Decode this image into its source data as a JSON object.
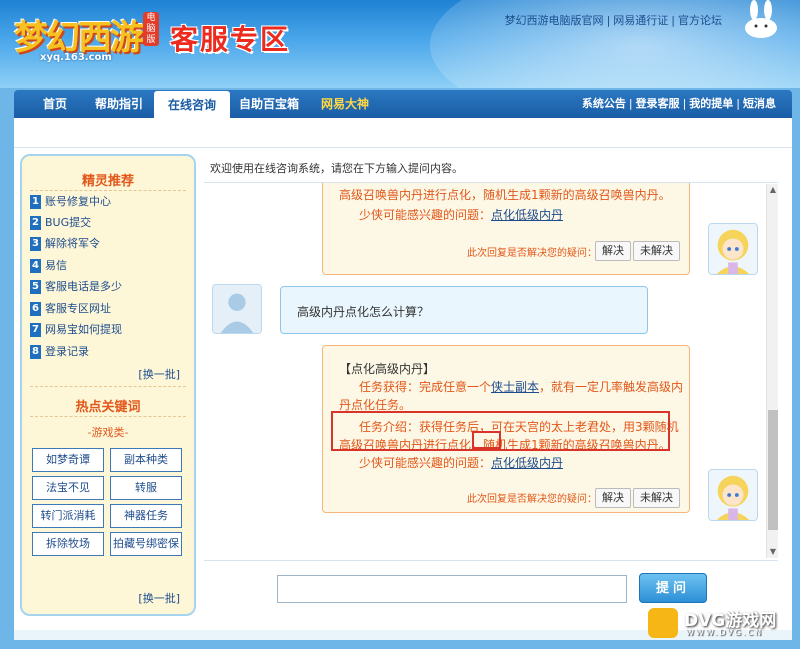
{
  "header": {
    "logo_text": "梦幻西游",
    "logo_tag": "电脑版",
    "logo_url": "xyq.163.com",
    "zone_title": "客服专区",
    "top_links": [
      "梦幻西游电脑版官网",
      "网易通行证",
      "官方论坛"
    ]
  },
  "nav": {
    "items": [
      "首页",
      "帮助指引",
      "在线咨询",
      "自助百宝箱",
      "网易大神"
    ],
    "active": "在线咨询",
    "right_links": [
      "系统公告",
      "登录客服",
      "我的提单",
      "短消息"
    ]
  },
  "left_panel": {
    "title": "精灵推荐",
    "items": [
      {
        "num": "1",
        "label": "账号修复中心"
      },
      {
        "num": "2",
        "label": "BUG提交"
      },
      {
        "num": "3",
        "label": "解除将军令"
      },
      {
        "num": "4",
        "label": "易信"
      },
      {
        "num": "5",
        "label": "客服电话是多少"
      },
      {
        "num": "6",
        "label": "客服专区网址"
      },
      {
        "num": "7",
        "label": "网易宝如何提现"
      },
      {
        "num": "8",
        "label": "登录记录"
      }
    ],
    "more_label": "[换一批]",
    "keywords_title": "热点关键词",
    "keywords_sub": "-游戏类-",
    "keywords": [
      "如梦奇谭",
      "副本种类",
      "法宝不见",
      "转服",
      "转门派消耗",
      "神器任务",
      "拆除牧场",
      "拍藏号绑密保"
    ],
    "keywords_more": "[换一批]"
  },
  "chat": {
    "welcome": "欢迎使用在线咨询系统，请您在下方输入提问内容。",
    "msg1": {
      "line1": "高级召唤兽内丹进行点化，随机生成1颗新的高级召唤兽内丹。",
      "line2_prefix": "少侠可能感兴趣的问题：",
      "line2_link": "点化低级内丹",
      "feedback": "此次回复是否解决您的疑问：",
      "solved": "解决",
      "unsolved": "未解决"
    },
    "user_msg": "高级内丹点化怎么计算？",
    "msg2": {
      "title": "【点化高级内丹】",
      "get_prefix": "任务获得：完成任意一个",
      "get_link": "侠士副本",
      "get_suffix": "，就有一定几率触发高级内",
      "get_cont": "丹点化任务。",
      "intro1": "任务介绍：获得任务后，可在天宫的太上老君处，用3颗随机",
      "intro2_a": "高级召唤兽内丹进行点化，",
      "intro2_b": "随机",
      "intro2_c": "生成1颗新的高级召唤兽内丹。",
      "line_prefix": "少侠可能感兴趣的问题：",
      "line_link": "点化低级内丹",
      "feedback": "此次回复是否解决您的疑问：",
      "solved": "解决",
      "unsolved": "未解决"
    }
  },
  "input": {
    "value": "",
    "button": "提问"
  },
  "watermark": {
    "text": "DVG游戏网",
    "sub": "WWW.DVG.CN"
  }
}
